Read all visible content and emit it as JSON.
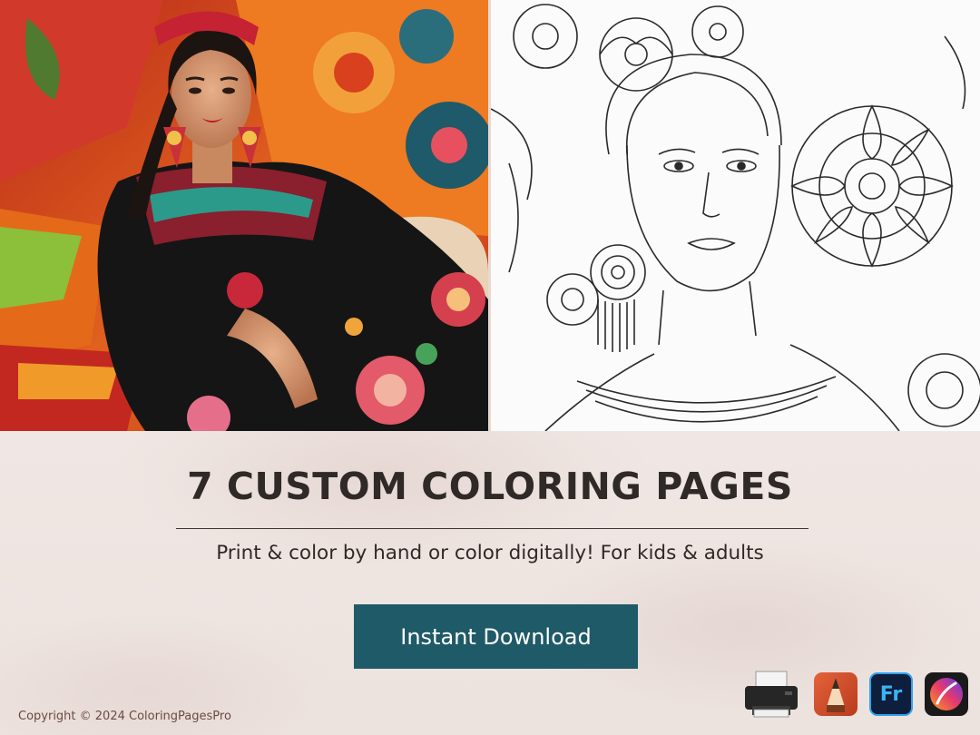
{
  "headline": "7 CUSTOM COLORING PAGES",
  "subline": "Print & color by hand or color digitally! For kids & adults",
  "cta": {
    "label": "Instant Download"
  },
  "copyright": "Copyright © 2024 ColoringPagesPro",
  "images": {
    "left": {
      "icon": "colored-portrait-illustration"
    },
    "right": {
      "icon": "line-art-coloring-page"
    }
  },
  "app_icons": [
    {
      "name": "printer-icon"
    },
    {
      "name": "pencil-app-icon"
    },
    {
      "name": "fresco-app-icon",
      "text": "Fr"
    },
    {
      "name": "procreate-app-icon"
    }
  ],
  "colors": {
    "button": "#1f5a68",
    "headline": "#2f2a27",
    "background": "#efe6e2",
    "copyright": "#6a4b42"
  }
}
